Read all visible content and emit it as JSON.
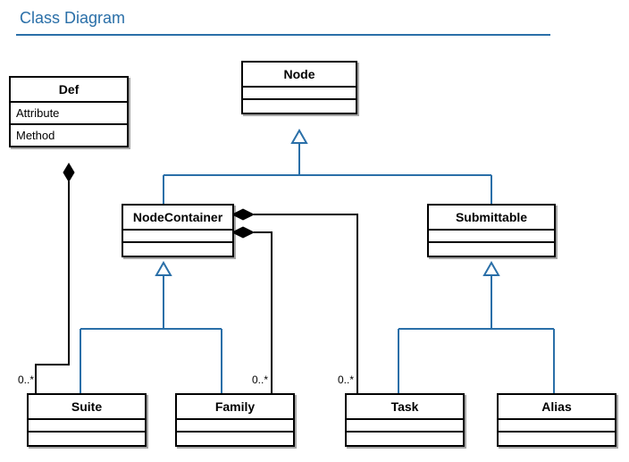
{
  "title": "Class Diagram",
  "node": {
    "name": "Node"
  },
  "def": {
    "name": "Def",
    "attribute": "Attribute",
    "method": "Method"
  },
  "nodecontainer": {
    "name": "NodeContainer"
  },
  "submittable": {
    "name": "Submittable"
  },
  "suite": {
    "name": "Suite"
  },
  "family": {
    "name": "Family"
  },
  "task": {
    "name": "Task"
  },
  "alias": {
    "name": "Alias"
  },
  "mult": {
    "suite": "0..*",
    "family": "0..*",
    "task": "0..*"
  },
  "relationships": [
    {
      "type": "generalization",
      "subclass": "NodeContainer",
      "superclass": "Node"
    },
    {
      "type": "generalization",
      "subclass": "Submittable",
      "superclass": "Node"
    },
    {
      "type": "generalization",
      "subclass": "Suite",
      "superclass": "NodeContainer"
    },
    {
      "type": "generalization",
      "subclass": "Family",
      "superclass": "NodeContainer"
    },
    {
      "type": "generalization",
      "subclass": "Task",
      "superclass": "Submittable"
    },
    {
      "type": "generalization",
      "subclass": "Alias",
      "superclass": "Submittable"
    },
    {
      "type": "composition",
      "whole": "Def",
      "part": "Suite",
      "multiplicity": "0..*"
    },
    {
      "type": "composition",
      "whole": "NodeContainer",
      "part": "Family",
      "multiplicity": "0..*"
    },
    {
      "type": "composition",
      "whole": "NodeContainer",
      "part": "Task",
      "multiplicity": "0..*"
    }
  ]
}
